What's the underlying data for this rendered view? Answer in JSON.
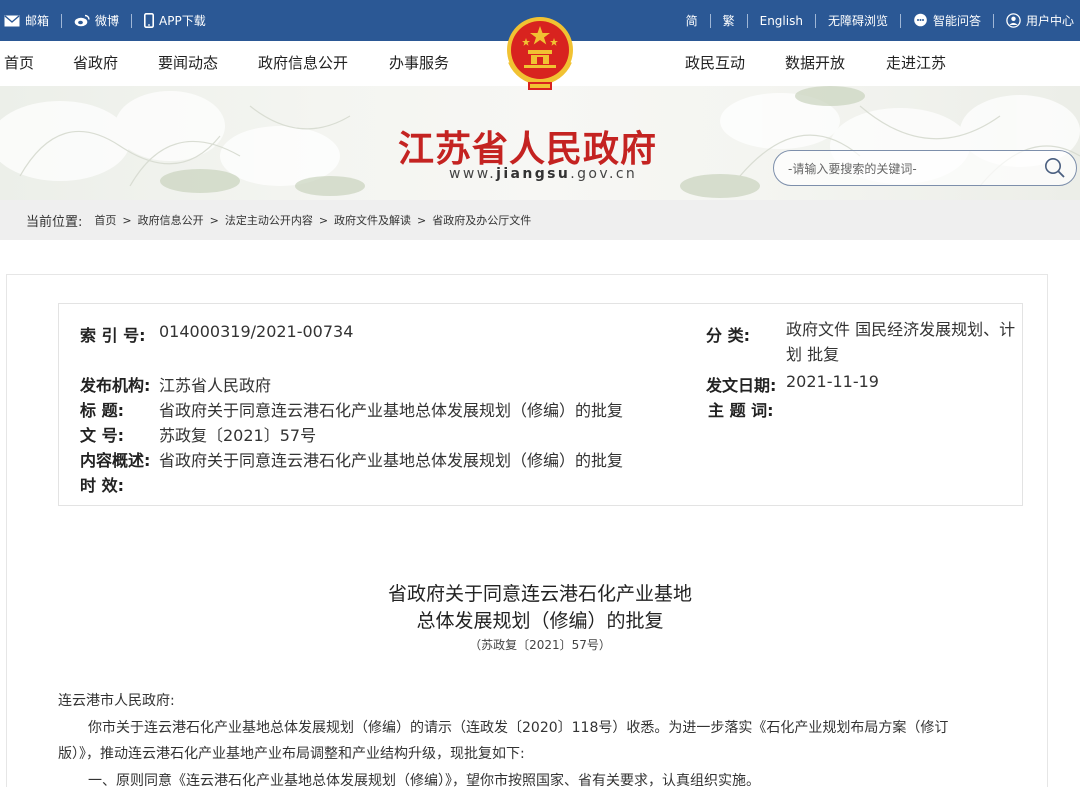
{
  "topbar": {
    "left": [
      {
        "icon": "mail-icon",
        "label": "邮箱"
      },
      {
        "icon": "weibo-icon",
        "label": "微博"
      },
      {
        "icon": "phone-icon",
        "label": "APP下载"
      }
    ],
    "right": [
      {
        "label": "简"
      },
      {
        "label": "繁"
      },
      {
        "label": "English"
      },
      {
        "label": "无障碍浏览"
      },
      {
        "icon": "chat-icon",
        "label": "智能问答"
      },
      {
        "icon": "user-icon",
        "label": "用户中心"
      }
    ]
  },
  "nav": {
    "left": [
      "首页",
      "省政府",
      "要闻动态",
      "政府信息公开",
      "办事服务"
    ],
    "right": [
      "政民互动",
      "数据开放",
      "走进江苏"
    ]
  },
  "banner": {
    "title": "江苏省人民政府",
    "url_prefix": "www.",
    "url_domain": "jiangsu",
    "url_suffix": ".gov.cn",
    "search_placeholder": "-请输入要搜索的关键词-"
  },
  "breadcrumb": {
    "label": "当前位置:",
    "items": [
      "首页",
      "政府信息公开",
      "法定主动公开内容",
      "政府文件及解读",
      "省政府及办公厅文件"
    ]
  },
  "meta": {
    "index_label": "索  引  号:",
    "index_value": "014000319/2021-00734",
    "category_label": "分        类:",
    "category_value": "政府文件 国民经济发展规划、计划 批复",
    "publisher_label": "发布机构:",
    "publisher_value": "江苏省人民政府",
    "date_label": "发文日期:",
    "date_value": "2021-11-19",
    "title_label": "标        题:",
    "title_value": "省政府关于同意连云港石化产业基地总体发展规划（修编）的批复",
    "keywords_label": "主  题  词:",
    "keywords_value": "",
    "docno_label": "文        号:",
    "docno_value": "苏政复〔2021〕57号",
    "summary_label": "内容概述:",
    "summary_value": "省政府关于同意连云港石化产业基地总体发展规划（修编）的批复",
    "validity_label": "时        效:",
    "validity_value": ""
  },
  "article": {
    "title_line1": "省政府关于同意连云港石化产业基地",
    "title_line2": "总体发展规划（修编）的批复",
    "subtitle": "（苏政复〔2021〕57号）",
    "salutation": "连云港市人民政府:",
    "para1_line1": "你市关于连云港石化产业基地总体发展规划（修编）的请示（连政发〔2020〕118号）收悉。为进一步落实《石化产业规划布局方案（修订",
    "para1_line2": "版）》，推动连云港石化产业基地产业布局调整和产业结构升级，现批复如下:",
    "para2": "一、原则同意《连云港石化产业基地总体发展规划（修编）》，望你市按照国家、省有关要求，认真组织实施。"
  },
  "colors": {
    "topbar": "#2b5895",
    "title_red": "#c42321",
    "emblem_red": "#d8231f",
    "emblem_gold": "#f1c232"
  }
}
